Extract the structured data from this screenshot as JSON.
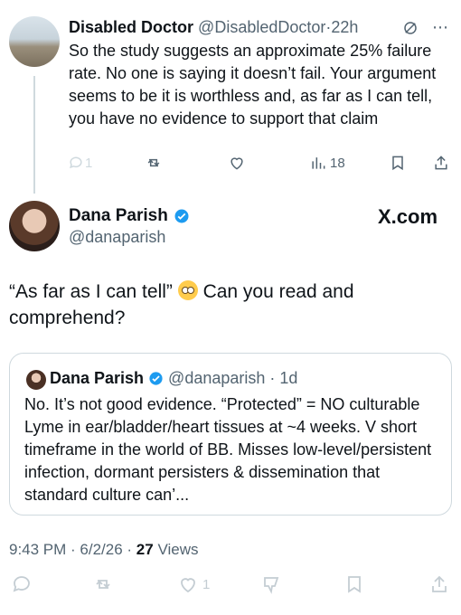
{
  "reply": {
    "display_name": "Disabled Doctor",
    "handle": "@DisabledDoctor",
    "separator": "·",
    "time": "22h",
    "text": "So the study suggests an approximate 25% failure rate. No one is saying it doesn’t fail. Your argument seems to be it is worthless and, as far as I can tell, you have no evidence to support that claim",
    "reply_count": "1",
    "views": "18"
  },
  "main": {
    "display_name": "Dana Parish",
    "handle": "@danaparish",
    "watermark": "X.com",
    "text_before_emoji": "“As far as I can tell” ",
    "emoji_name": "face-with-rolling-eyes",
    "text_after_emoji": " Can you read and comprehend?"
  },
  "quote": {
    "display_name": "Dana Parish",
    "handle": "@danaparish",
    "separator": "·",
    "time": "1d",
    "text": "No. It’s not good evidence. “Protected” = NO culturable Lyme in ear/bladder/heart tissues at ~4 weeks. V short timeframe in the world of BB. Misses low-level/persistent infection, dormant persisters & dissemination that standard culture can’..."
  },
  "footer": {
    "time": "9:43 PM · 6/2/26 · ",
    "views_count": "27",
    "views_label": " Views",
    "like_count": "1"
  },
  "colors": {
    "verified": "#1d9bf0",
    "muted": "#536471",
    "divider": "#cfd9de"
  }
}
